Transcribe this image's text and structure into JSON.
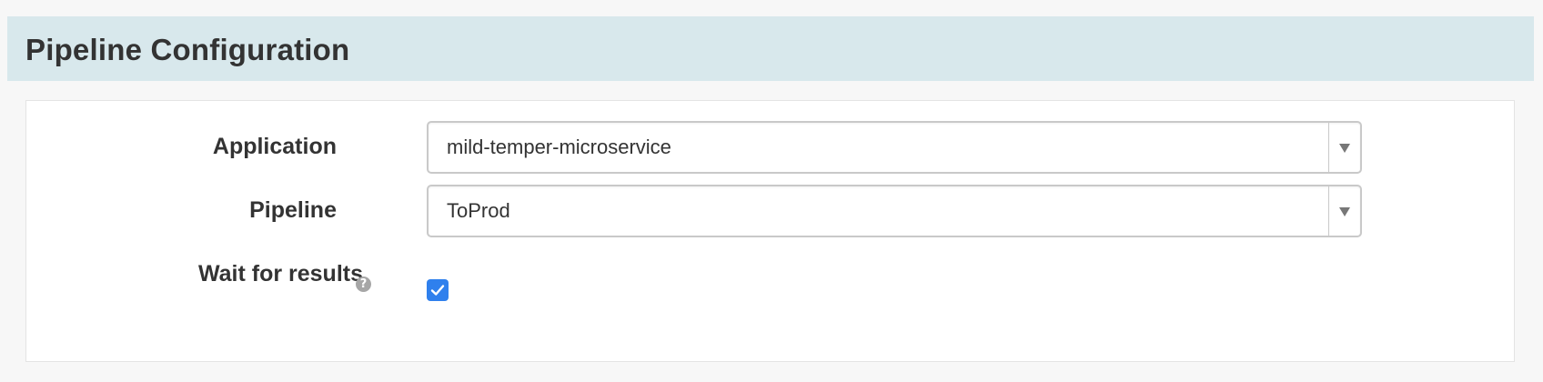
{
  "header": {
    "title": "Pipeline Configuration"
  },
  "form": {
    "application": {
      "label": "Application",
      "value": "mild-temper-microservice"
    },
    "pipeline": {
      "label": "Pipeline",
      "value": "ToProd"
    },
    "wait_for_results": {
      "label": "Wait for results",
      "checked": true,
      "help_icon": "question-circle-icon"
    }
  },
  "colors": {
    "header_bg": "#d8e8ec",
    "checkbox_blue": "#2f80ed",
    "text": "#333333"
  }
}
